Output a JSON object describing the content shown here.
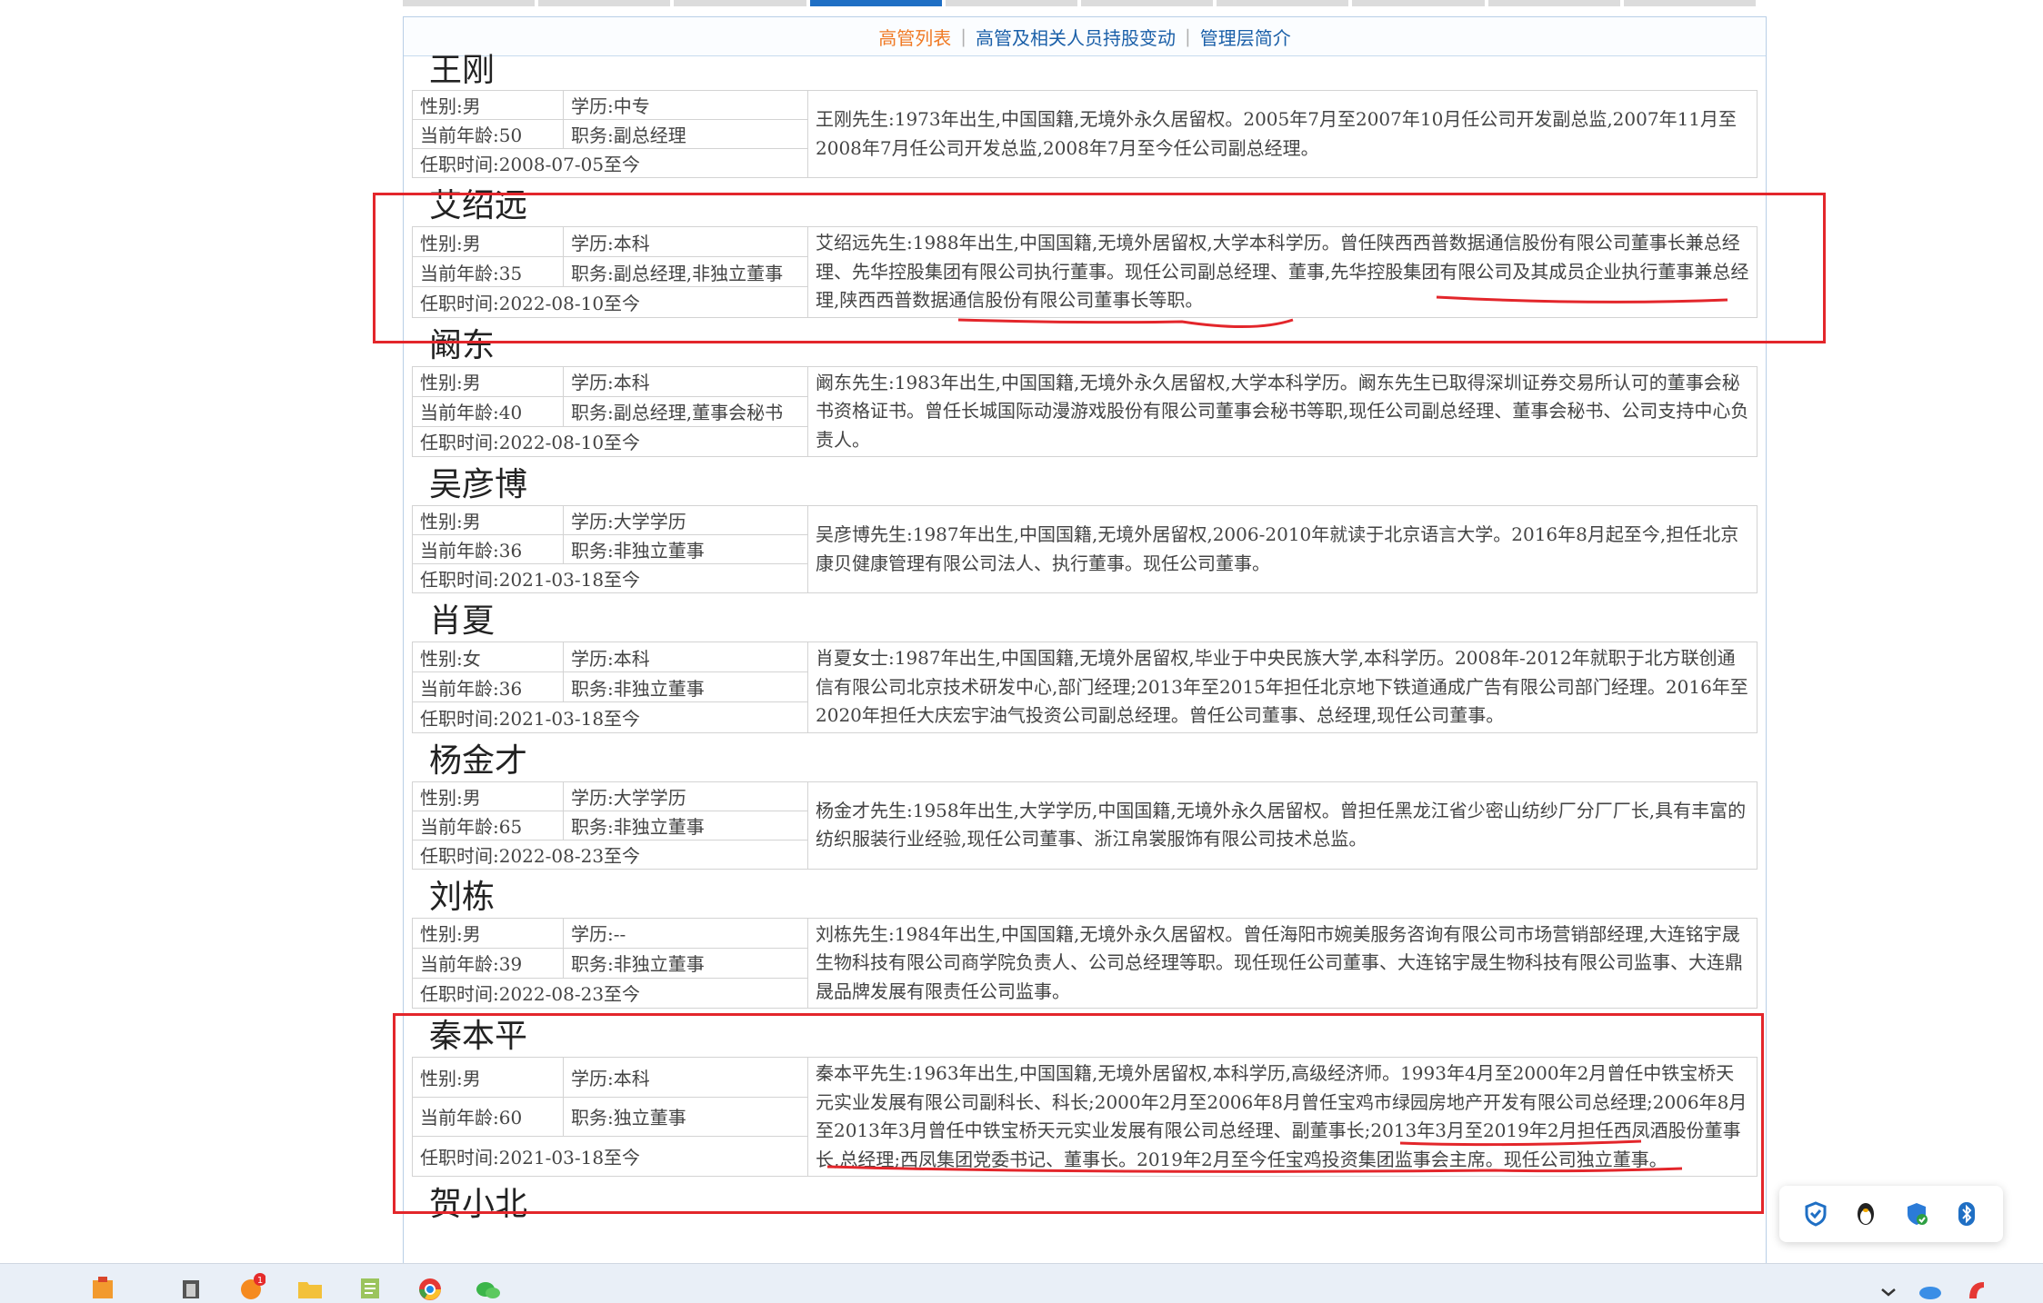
{
  "subnav": {
    "tab1": "高管列表",
    "tab2": "高管及相关人员持股变动",
    "tab3": "管理层简介"
  },
  "people": [
    {
      "name": "王刚",
      "gender": "性别:男",
      "education": "学历:中专",
      "age": "当前年龄:50",
      "position": "职务:副总经理",
      "tenure": "任职时间:2008-07-05至今",
      "bio": "王刚先生:1973年出生,中国国籍,无境外永久居留权。2005年7月至2007年10月任公司开发副总监,2007年11月至2008年7月任公司开发总监,2008年7月至今任公司副总经理。"
    },
    {
      "name": "艾绍远",
      "gender": "性别:男",
      "education": "学历:本科",
      "age": "当前年龄:35",
      "position": "职务:副总经理,非独立董事",
      "tenure": "任职时间:2022-08-10至今",
      "bio": "艾绍远先生:1988年出生,中国国籍,无境外居留权,大学本科学历。曾任陕西西普数据通信股份有限公司董事长兼总经理、先华控股集团有限公司执行董事。现任公司副总经理、董事,先华控股集团有限公司及其成员企业执行董事兼总经理,陕西西普数据通信股份有限公司董事长等职。"
    },
    {
      "name": "阚东",
      "gender": "性别:男",
      "education": "学历:本科",
      "age": "当前年龄:40",
      "position": "职务:副总经理,董事会秘书",
      "tenure": "任职时间:2022-08-10至今",
      "bio": "阚东先生:1983年出生,中国国籍,无境外永久居留权,大学本科学历。阚东先生已取得深圳证券交易所认可的董事会秘书资格证书。曾任长城国际动漫游戏股份有限公司董事会秘书等职,现任公司副总经理、董事会秘书、公司支持中心负责人。"
    },
    {
      "name": "吴彦博",
      "gender": "性别:男",
      "education": "学历:大学学历",
      "age": "当前年龄:36",
      "position": "职务:非独立董事",
      "tenure": "任职时间:2021-03-18至今",
      "bio": "吴彦博先生:1987年出生,中国国籍,无境外居留权,2006-2010年就读于北京语言大学。2016年8月起至今,担任北京康贝健康管理有限公司法人、执行董事。现任公司董事。"
    },
    {
      "name": "肖夏",
      "gender": "性别:女",
      "education": "学历:本科",
      "age": "当前年龄:36",
      "position": "职务:非独立董事",
      "tenure": "任职时间:2021-03-18至今",
      "bio": "肖夏女士:1987年出生,中国国籍,无境外居留权,毕业于中央民族大学,本科学历。2008年-2012年就职于北方联创通信有限公司北京技术研发中心,部门经理;2013年至2015年担任北京地下铁道通成广告有限公司部门经理。2016年至2020年担任大庆宏宇油气投资公司副总经理。曾任公司董事、总经理,现任公司董事。"
    },
    {
      "name": "杨金才",
      "gender": "性别:男",
      "education": "学历:大学学历",
      "age": "当前年龄:65",
      "position": "职务:非独立董事",
      "tenure": "任职时间:2022-08-23至今",
      "bio": "杨金才先生:1958年出生,大学学历,中国国籍,无境外永久居留权。曾担任黑龙江省少密山纺纱厂分厂厂长,具有丰富的纺织服装行业经验,现任公司董事、浙江帛裳服饰有限公司技术总监。"
    },
    {
      "name": "刘栋",
      "gender": "性别:男",
      "education": "学历:--",
      "age": "当前年龄:39",
      "position": "职务:非独立董事",
      "tenure": "任职时间:2022-08-23至今",
      "bio": "刘栋先生:1984年出生,中国国籍,无境外永久居留权。曾任海阳市婉美服务咨询有限公司市场营销部经理,大连铭宇晟生物科技有限公司商学院负责人、公司总经理等职。现任现任公司董事、大连铭宇晟生物科技有限公司监事、大连鼎晟品牌发展有限责任公司监事。"
    },
    {
      "name": "秦本平",
      "gender": "性别:男",
      "education": "学历:本科",
      "age": "当前年龄:60",
      "position": "职务:独立董事",
      "tenure": "任职时间:2021-03-18至今",
      "bio": "秦本平先生:1963年出生,中国国籍,无境外居留权,本科学历,高级经济师。1993年4月至2000年2月曾任中铁宝桥天元实业发展有限公司副科长、科长;2000年2月至2006年8月曾任宝鸡市绿园房地产开发有限公司总经理;2006年8月至2013年3月曾任中铁宝桥天元实业发展有限公司总经理、副董事长;2013年3月至2019年2月担任西凤酒股份董事长,总经理;西凤集团党委书记、董事长。2019年2月至今任宝鸡投资集团监事会主席。现任公司独立董事。"
    },
    {
      "name": "贺小北"
    }
  ],
  "icons": {
    "widget": [
      "shield-icon",
      "penguin-icon",
      "security-check-icon",
      "bluetooth-icon"
    ],
    "taskbar": [
      "app-icon",
      "app-icon",
      "notification-app-icon",
      "folder-icon",
      "notepad-icon",
      "chrome-icon",
      "wechat-icon"
    ],
    "tray": [
      "chevron-up-icon",
      "cloud-icon",
      "antivirus-icon"
    ]
  },
  "taskbar": {
    "badge": "1"
  },
  "colors": {
    "accent": "#1f6fc4",
    "active_tab_text": "#f07a25",
    "highlight": "#e3262b"
  }
}
